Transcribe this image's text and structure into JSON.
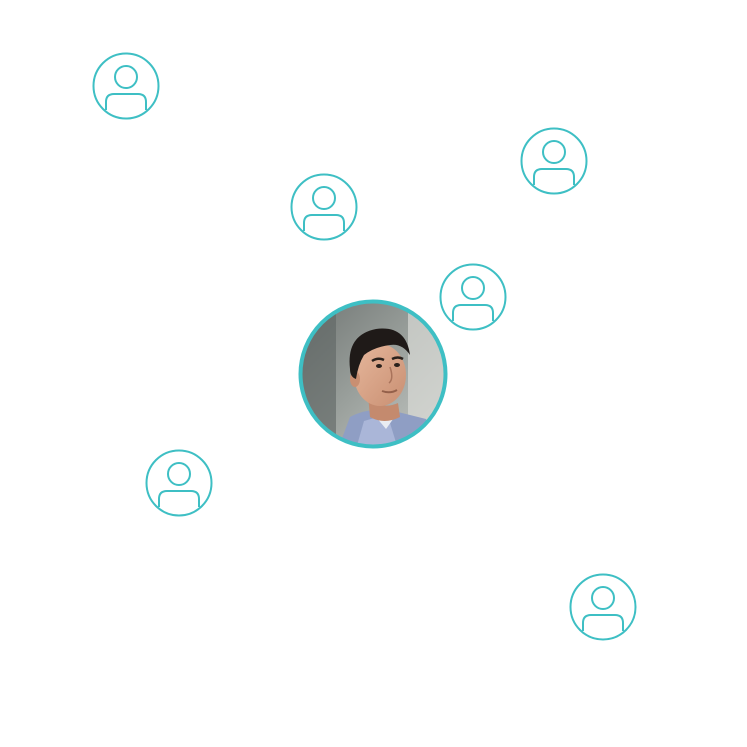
{
  "colors": {
    "accent": "#3ebfc4",
    "background": "#ffffff"
  },
  "nodes": [
    {
      "icon": "user-outline-icon"
    },
    {
      "icon": "user-outline-icon"
    },
    {
      "icon": "user-outline-icon"
    },
    {
      "icon": "user-outline-icon"
    },
    {
      "icon": "user-outline-icon"
    },
    {
      "icon": "user-outline-icon"
    }
  ],
  "center": {
    "icon": "profile-photo"
  }
}
